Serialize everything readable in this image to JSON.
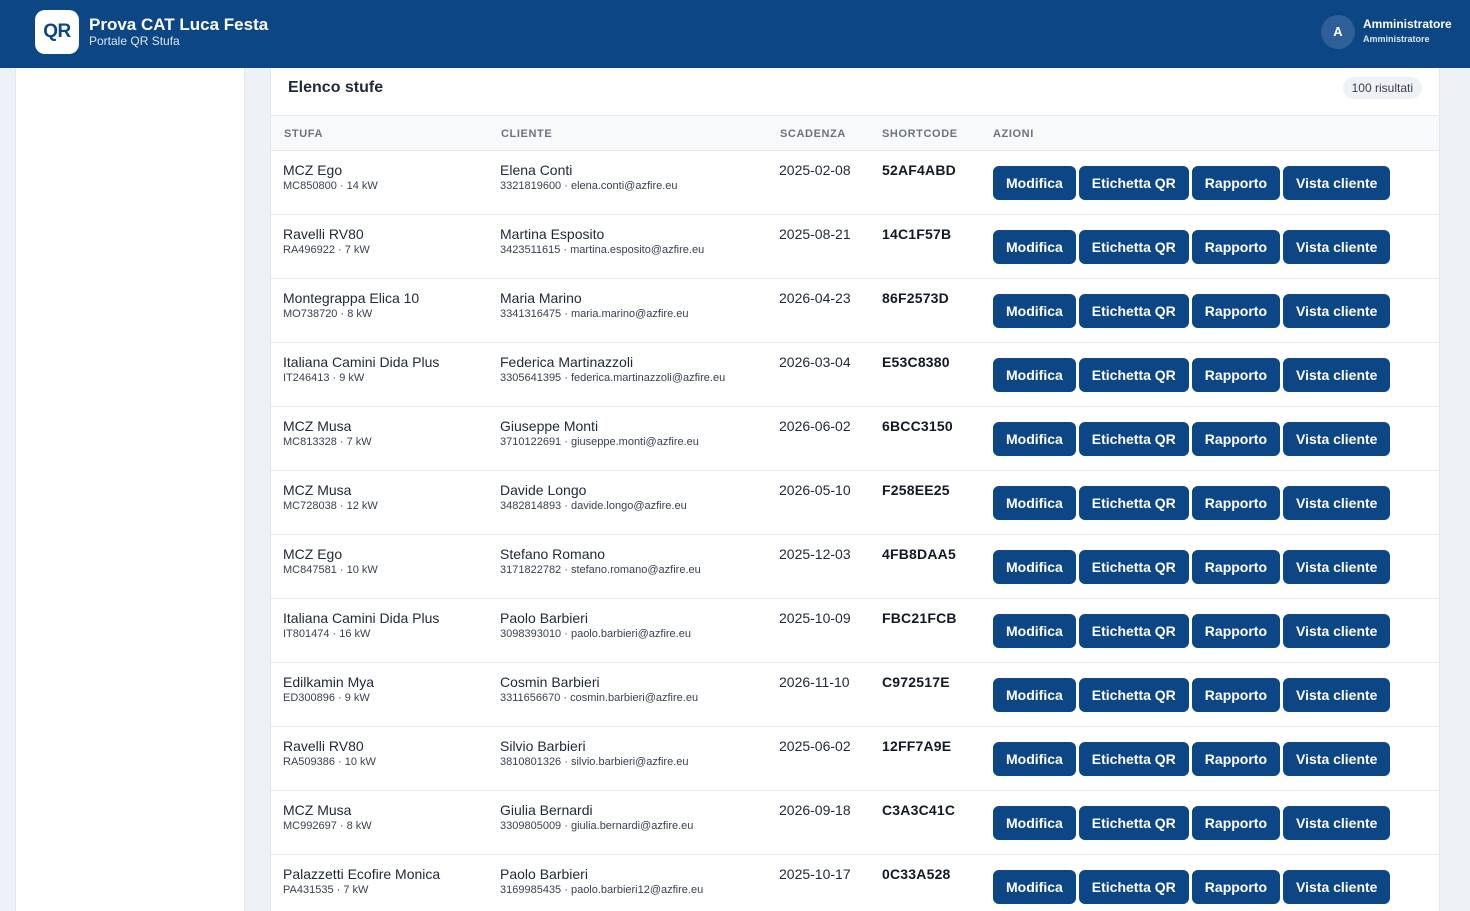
{
  "header": {
    "logo_text": "QR",
    "title": "Prova CAT Luca Festa",
    "subtitle": "Portale QR Stufa",
    "user_initial": "A",
    "user_name": "Amministratore",
    "user_role": "Amministratore"
  },
  "list": {
    "title": "Elenco stufe",
    "count": "100 risultati",
    "columns": {
      "stufa": "STUFA",
      "cliente": "CLIENTE",
      "scadenza": "SCADENZA",
      "shortcode": "SHORTCODE",
      "azioni": "AZIONI"
    },
    "action_labels": {
      "edit": "Modifica",
      "qr": "Etichetta QR",
      "report": "Rapporto",
      "client_view": "Vista cliente"
    },
    "rows": [
      {
        "stove": "MCZ Ego",
        "stove_detail": "MC850800 · 14 kW",
        "client": "Elena Conti",
        "client_detail": "3321819600 · elena.conti@azfire.eu",
        "due": "2025-02-08",
        "code": "52AF4ABD"
      },
      {
        "stove": "Ravelli RV80",
        "stove_detail": "RA496922 · 7 kW",
        "client": "Martina Esposito",
        "client_detail": "3423511615 · martina.esposito@azfire.eu",
        "due": "2025-08-21",
        "code": "14C1F57B"
      },
      {
        "stove": "Montegrappa Elica 10",
        "stove_detail": "MO738720 · 8 kW",
        "client": "Maria Marino",
        "client_detail": "3341316475 · maria.marino@azfire.eu",
        "due": "2026-04-23",
        "code": "86F2573D"
      },
      {
        "stove": "Italiana Camini Dida Plus",
        "stove_detail": "IT246413 · 9 kW",
        "client": "Federica Martinazzoli",
        "client_detail": "3305641395 · federica.martinazzoli@azfire.eu",
        "due": "2026-03-04",
        "code": "E53C8380"
      },
      {
        "stove": "MCZ Musa",
        "stove_detail": "MC813328 · 7 kW",
        "client": "Giuseppe Monti",
        "client_detail": "3710122691 · giuseppe.monti@azfire.eu",
        "due": "2026-06-02",
        "code": "6BCC3150"
      },
      {
        "stove": "MCZ Musa",
        "stove_detail": "MC728038 · 12 kW",
        "client": "Davide Longo",
        "client_detail": "3482814893 · davide.longo@azfire.eu",
        "due": "2026-05-10",
        "code": "F258EE25"
      },
      {
        "stove": "MCZ Ego",
        "stove_detail": "MC847581 · 10 kW",
        "client": "Stefano Romano",
        "client_detail": "3171822782 · stefano.romano@azfire.eu",
        "due": "2025-12-03",
        "code": "4FB8DAA5"
      },
      {
        "stove": "Italiana Camini Dida Plus",
        "stove_detail": "IT801474 · 16 kW",
        "client": "Paolo Barbieri",
        "client_detail": "3098393010 · paolo.barbieri@azfire.eu",
        "due": "2025-10-09",
        "code": "FBC21FCB"
      },
      {
        "stove": "Edilkamin Mya",
        "stove_detail": "ED300896 · 9 kW",
        "client": "Cosmin Barbieri",
        "client_detail": "3311656670 · cosmin.barbieri@azfire.eu",
        "due": "2026-11-10",
        "code": "C972517E"
      },
      {
        "stove": "Ravelli RV80",
        "stove_detail": "RA509386 · 10 kW",
        "client": "Silvio Barbieri",
        "client_detail": "3810801326 · silvio.barbieri@azfire.eu",
        "due": "2025-06-02",
        "code": "12FF7A9E"
      },
      {
        "stove": "MCZ Musa",
        "stove_detail": "MC992697 · 8 kW",
        "client": "Giulia Bernardi",
        "client_detail": "3309805009 · giulia.bernardi@azfire.eu",
        "due": "2026-09-18",
        "code": "C3A3C41C"
      },
      {
        "stove": "Palazzetti Ecofire Monica",
        "stove_detail": "PA431535 · 7 kW",
        "client": "Paolo Barbieri",
        "client_detail": "3169985435 · paolo.barbieri12@azfire.eu",
        "due": "2025-10-17",
        "code": "0C33A528"
      }
    ]
  }
}
